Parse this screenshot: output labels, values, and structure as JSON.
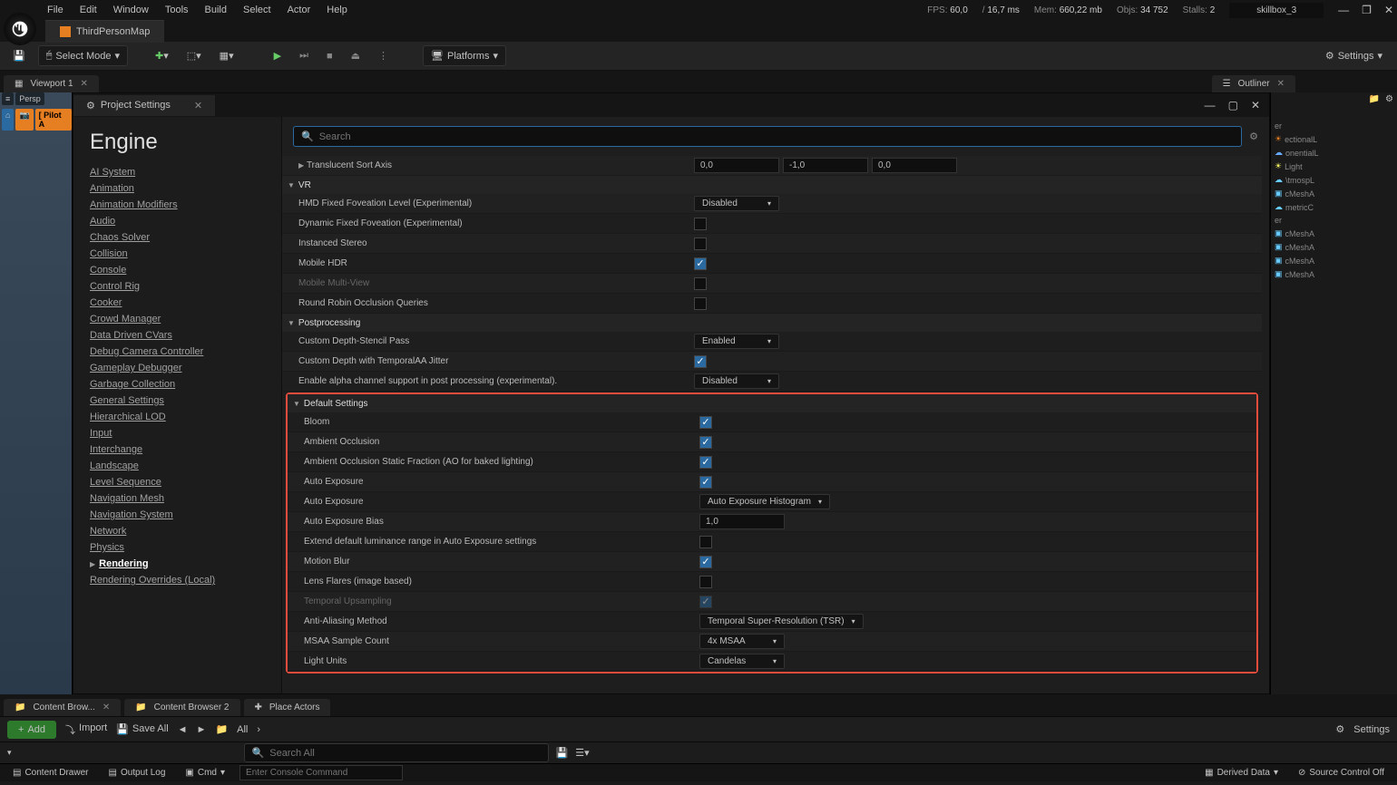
{
  "menu": [
    "File",
    "Edit",
    "Window",
    "Tools",
    "Build",
    "Select",
    "Actor",
    "Help"
  ],
  "stats": {
    "fps_label": "FPS:",
    "fps": "60,0",
    "frame_label": "/",
    "frame": "16,7 ms",
    "mem_label": "Mem:",
    "mem": "660,22 mb",
    "objs_label": "Objs:",
    "objs": "34 752",
    "stalls_label": "Stalls:",
    "stalls": "2"
  },
  "user": "skillbox_3",
  "main_tab": "ThirdPersonMap",
  "toolbar": {
    "select_mode": "Select Mode",
    "platforms": "Platforms",
    "settings": "Settings"
  },
  "viewport_tab": "Viewport 1",
  "outliner_tab": "Outliner",
  "viewport": {
    "perspective": "Persp",
    "pilot": "[ Pilot A"
  },
  "outliner_items": [
    "er",
    "ectionalL",
    "onentialL",
    "Light",
    "\\tmospL",
    "cMeshA",
    "metricC",
    "er",
    "cMeshA",
    "cMeshA",
    "cMeshA",
    "cMeshA"
  ],
  "project_settings_tab": "Project Settings",
  "search_placeholder": "Search",
  "sidebar": {
    "section": "Engine",
    "items": [
      "AI System",
      "Animation",
      "Animation Modifiers",
      "Audio",
      "Chaos Solver",
      "Collision",
      "Console",
      "Control Rig",
      "Cooker",
      "Crowd Manager",
      "Data Driven CVars",
      "Debug Camera Controller",
      "Gameplay Debugger",
      "Garbage Collection",
      "General Settings",
      "Hierarchical LOD",
      "Input",
      "Interchange",
      "Landscape",
      "Level Sequence",
      "Navigation Mesh",
      "Navigation System",
      "Network",
      "Physics",
      "Rendering",
      "Rendering Overrides (Local)"
    ]
  },
  "props": {
    "translucent_sort_axis": "Translucent Sort Axis",
    "tsa_vals": [
      "0,0",
      "-1,0",
      "0,0"
    ],
    "vr": "VR",
    "hmd": "HMD Fixed Foveation Level (Experimental)",
    "hmd_v": "Disabled",
    "dyn": "Dynamic Fixed Foveation (Experimental)",
    "inst": "Instanced Stereo",
    "mhdr": "Mobile HDR",
    "mmv": "Mobile Multi-View",
    "rro": "Round Robin Occlusion Queries",
    "postprocessing": "Postprocessing",
    "cds": "Custom Depth-Stencil Pass",
    "cds_v": "Enabled",
    "cdt": "Custom Depth with TemporalAA Jitter",
    "alpha": "Enable alpha channel support in post processing (experimental).",
    "alpha_v": "Disabled",
    "default_settings": "Default Settings",
    "bloom": "Bloom",
    "ao": "Ambient Occlusion",
    "aos": "Ambient Occlusion Static Fraction (AO for baked lighting)",
    "ae": "Auto Exposure",
    "ae2": "Auto Exposure",
    "ae2_v": "Auto Exposure Histogram",
    "aeb": "Auto Exposure Bias",
    "aeb_v": "1,0",
    "ext": "Extend default luminance range in Auto Exposure settings",
    "mb": "Motion Blur",
    "lf": "Lens Flares (image based)",
    "tu": "Temporal Upsampling",
    "aa": "Anti-Aliasing Method",
    "aa_v": "Temporal Super-Resolution (TSR)",
    "msaa": "MSAA Sample Count",
    "msaa_v": "4x MSAA",
    "lu": "Light Units",
    "lu_v": "Candelas"
  },
  "bottom_tabs": [
    "Content Brow...",
    "Content Browser 2",
    "Place Actors"
  ],
  "bottom_toolbar": {
    "add": "Add",
    "import": "Import",
    "save_all": "Save All",
    "all": "All",
    "settings": "Settings"
  },
  "bottom_search_placeholder": "Search All",
  "statusbar": {
    "content_drawer": "Content Drawer",
    "output_log": "Output Log",
    "cmd": "Cmd",
    "console_placeholder": "Enter Console Command",
    "derived": "Derived Data",
    "source": "Source Control Off"
  }
}
